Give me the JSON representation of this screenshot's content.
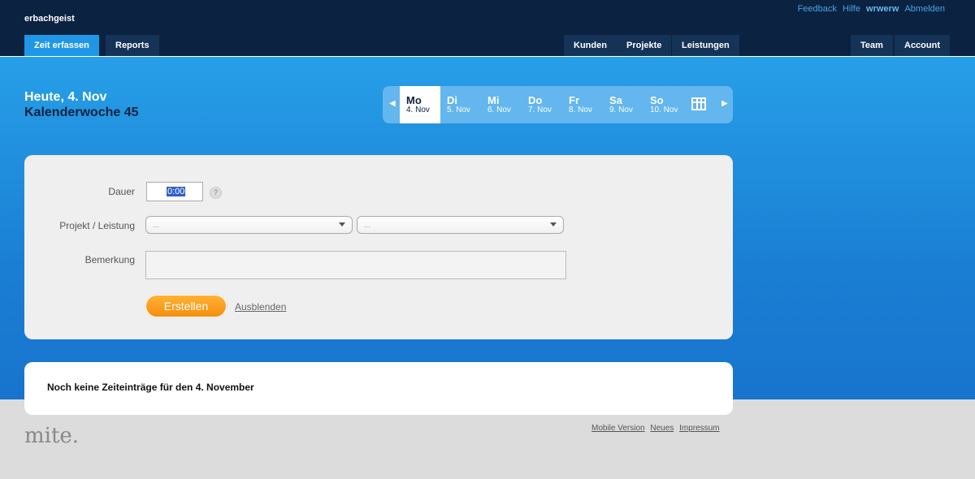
{
  "header": {
    "brand": "erbachgeist",
    "toplinks": {
      "feedback": "Feedback",
      "help": "Hilfe",
      "user": "wrwerw",
      "logout": "Abmelden"
    },
    "tabs_left": [
      {
        "label": "Zeit erfassen",
        "active": true
      },
      {
        "label": "Reports",
        "active": false
      }
    ],
    "tabs_mid": [
      {
        "label": "Kunden"
      },
      {
        "label": "Projekte"
      },
      {
        "label": "Leistungen"
      }
    ],
    "tabs_right": [
      {
        "label": "Team"
      },
      {
        "label": "Account"
      }
    ]
  },
  "date": {
    "today": "Heute, 4. Nov",
    "week": "Kalenderwoche 45"
  },
  "days": [
    {
      "name": "Mo",
      "date": "4. Nov",
      "active": true
    },
    {
      "name": "Di",
      "date": "5. Nov"
    },
    {
      "name": "Mi",
      "date": "6. Nov"
    },
    {
      "name": "Do",
      "date": "7. Nov"
    },
    {
      "name": "Fr",
      "date": "8. Nov"
    },
    {
      "name": "Sa",
      "date": "9. Nov"
    },
    {
      "name": "So",
      "date": "10. Nov"
    }
  ],
  "form": {
    "dauer_label": "Dauer",
    "dauer_value": "0:00",
    "help": "?",
    "projekt_label": "Projekt / Leistung",
    "projekt_placeholder": "...",
    "leistung_placeholder": "...",
    "bemerkung_label": "Bemerkung",
    "create_label": "Erstellen",
    "hide_label": "Ausblenden"
  },
  "entries": {
    "empty_message": "Noch keine Zeiteinträge für den 4. November"
  },
  "footer": {
    "logo": "mite.",
    "links": [
      "Mobile Version",
      "Neues",
      "Impressum"
    ]
  },
  "colors": {
    "header_bg": "#0b2240",
    "accent_blue": "#1f97e6",
    "button_orange": "#f7960f"
  }
}
